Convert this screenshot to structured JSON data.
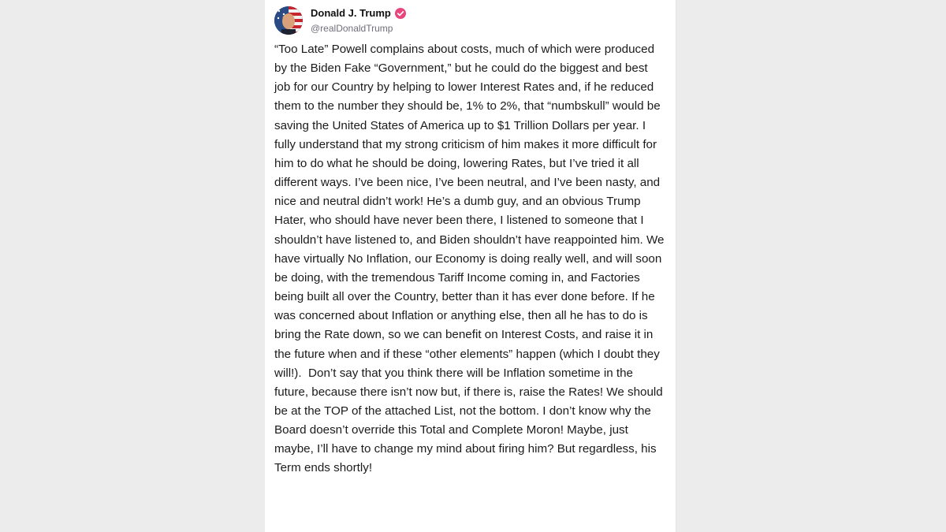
{
  "post": {
    "author": {
      "display_name": "Donald J. Trump",
      "handle": "@realDonaldTrump",
      "verified": true,
      "verified_icon": "verified-badge-icon",
      "badge_color": "#e8467c"
    },
    "text": "“Too Late” Powell complains about costs, much of which were produced by the Biden Fake “Government,” but he could do the biggest and best job for our Country by helping to lower Interest Rates and, if he reduced them to the number they should be, 1% to 2%, that “numbskull” would be saving the United States of America up to $1 Trillion Dollars per year. I fully understand that my strong criticism of him makes it more difficult for him to do what he should be doing, lowering Rates, but I’ve tried it all different ways. I’ve been nice, I’ve been neutral, and I’ve been nasty, and nice and neutral didn’t work! He’s a dumb guy, and an obvious Trump Hater, who should have never been there, I listened to someone that I shouldn’t have listened to, and Biden shouldn’t have reappointed him. We have virtually No Inflation, our Economy is doing really well, and will soon be doing, with the tremendous Tariff Income coming in, and Factories being built all over the Country, better than it has ever done before. If he was concerned about Inflation or anything else, then all he has to do is bring the Rate down, so we can benefit on Interest Costs, and raise it in the future when and if these “other elements” happen (which I doubt they will!).  Don’t say that you think there will be Inflation sometime in the future, because there isn’t now but, if there is, raise the Rates! We should be at the TOP of the attached List, not the bottom. I don’t know why the Board doesn’t override this Total and Complete Moron! Maybe, just maybe, I’ll have to change my mind about firing him? But regardless, his Term ends shortly!"
  }
}
